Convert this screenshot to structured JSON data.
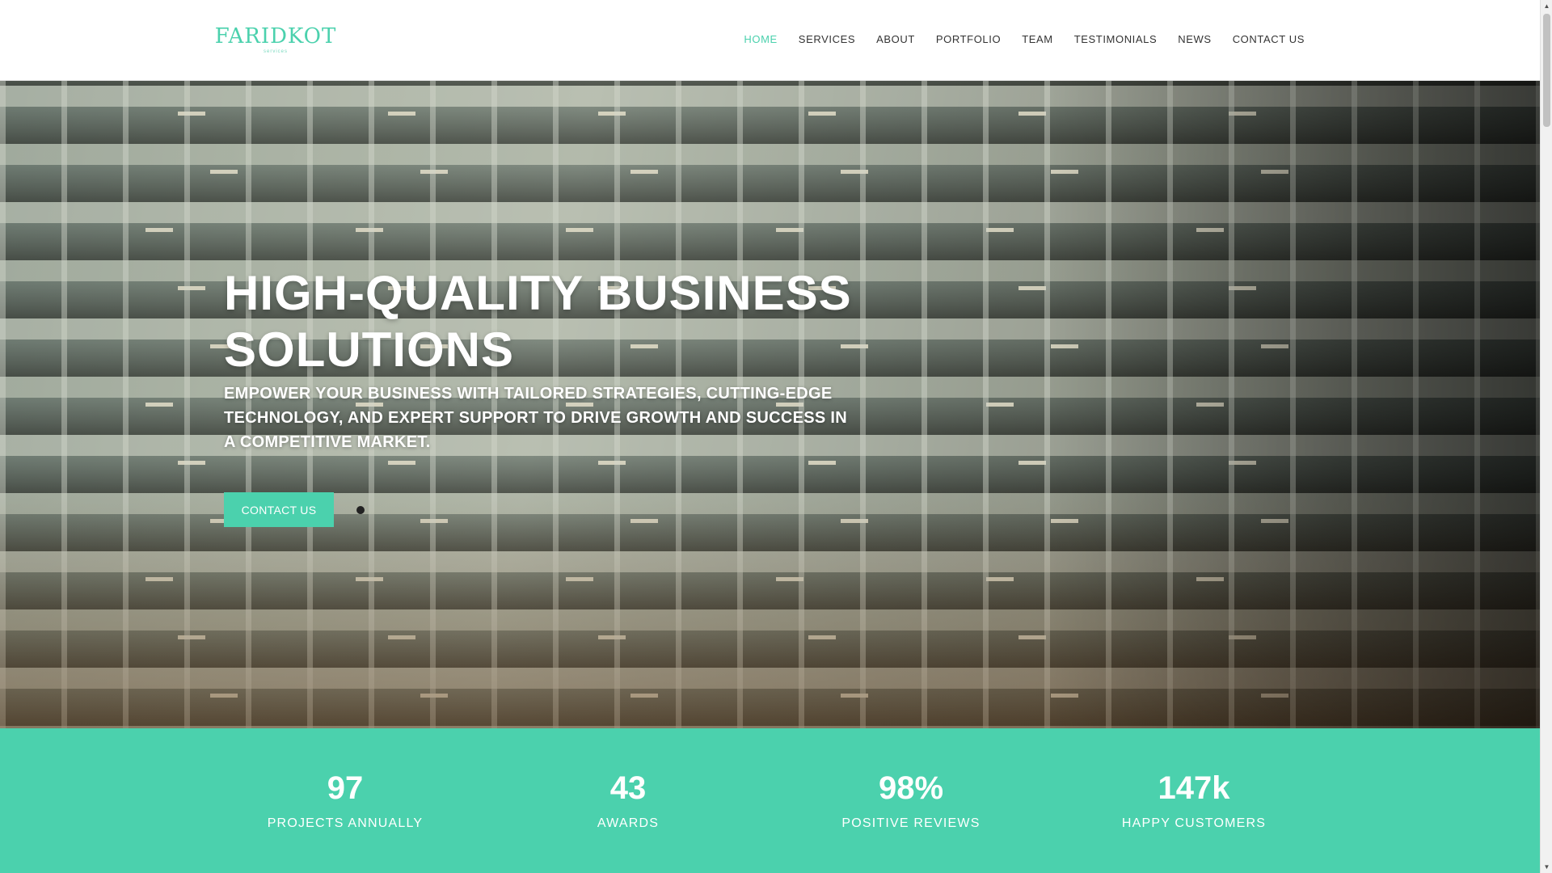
{
  "brand": {
    "logo_text": "FARIDKOT",
    "logo_subtext": "services",
    "accent_color": "#4bd1ad"
  },
  "nav": {
    "items": [
      {
        "label": "HOME",
        "active": true
      },
      {
        "label": "SERVICES",
        "active": false
      },
      {
        "label": "ABOUT",
        "active": false
      },
      {
        "label": "PORTFOLIO",
        "active": false
      },
      {
        "label": "TEAM",
        "active": false
      },
      {
        "label": "TESTIMONIALS",
        "active": false
      },
      {
        "label": "NEWS",
        "active": false
      },
      {
        "label": "CONTACT US",
        "active": false
      }
    ]
  },
  "hero": {
    "title": "HIGH-QUALITY BUSINESS SOLUTIONS",
    "subtitle": "EMPOWER YOUR BUSINESS WITH TAILORED STRATEGIES, CUTTING-EDGE TECHNOLOGY, AND EXPERT SUPPORT TO DRIVE GROWTH AND SUCCESS IN A COMPETITIVE MARKET.",
    "cta_label": "CONTACT US"
  },
  "stats": [
    {
      "value": "97",
      "label": "PROJECTS ANNUALLY"
    },
    {
      "value": "43",
      "label": "AWARDS"
    },
    {
      "value": "98%",
      "label": "POSITIVE REVIEWS"
    },
    {
      "value": "147k",
      "label": "HAPPY CUSTOMERS"
    }
  ],
  "scrollbar": {
    "up_icon": "chevron-up-icon",
    "down_icon": "chevron-down-icon"
  }
}
